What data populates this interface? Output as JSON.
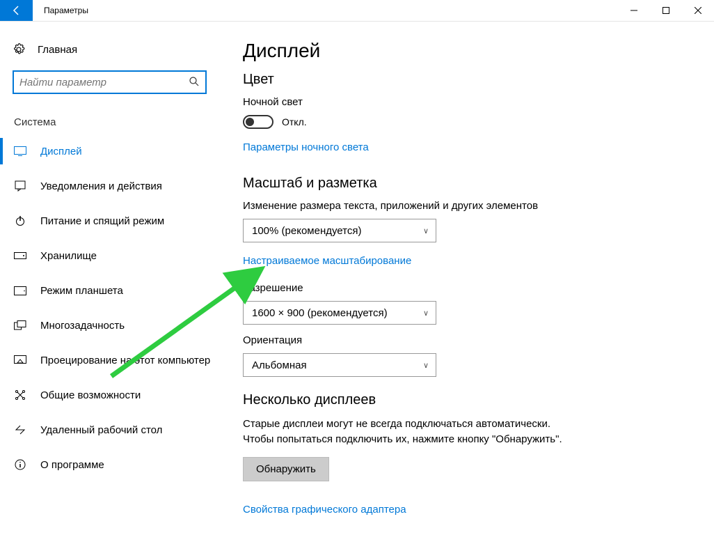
{
  "window": {
    "title": "Параметры"
  },
  "sidebar": {
    "home": "Главная",
    "search_placeholder": "Найти параметр",
    "section": "Система",
    "items": [
      {
        "label": "Дисплей"
      },
      {
        "label": "Уведомления и действия"
      },
      {
        "label": "Питание и спящий режим"
      },
      {
        "label": "Хранилище"
      },
      {
        "label": "Режим планшета"
      },
      {
        "label": "Многозадачность"
      },
      {
        "label": "Проецирование на этот компьютер"
      },
      {
        "label": "Общие возможности"
      },
      {
        "label": "Удаленный рабочий стол"
      },
      {
        "label": "О программе"
      }
    ]
  },
  "main": {
    "title": "Дисплей",
    "color": {
      "heading": "Цвет",
      "night_label": "Ночной свет",
      "toggle_state": "Откл.",
      "night_link": "Параметры ночного света"
    },
    "scale": {
      "heading": "Масштаб и разметка",
      "scale_label": "Изменение размера текста, приложений и других элементов",
      "scale_value": "100% (рекомендуется)",
      "custom_link": "Настраиваемое масштабирование",
      "resolution_label": "Разрешение",
      "resolution_value": "1600 × 900 (рекомендуется)",
      "orientation_label": "Ориентация",
      "orientation_value": "Альбомная"
    },
    "multi": {
      "heading": "Несколько дисплеев",
      "body": "Старые дисплеи могут не всегда подключаться автоматически. Чтобы попытаться подключить их, нажмите кнопку \"Обнаружить\".",
      "detect_btn": "Обнаружить",
      "gpu_link": "Свойства графического адаптера"
    }
  }
}
